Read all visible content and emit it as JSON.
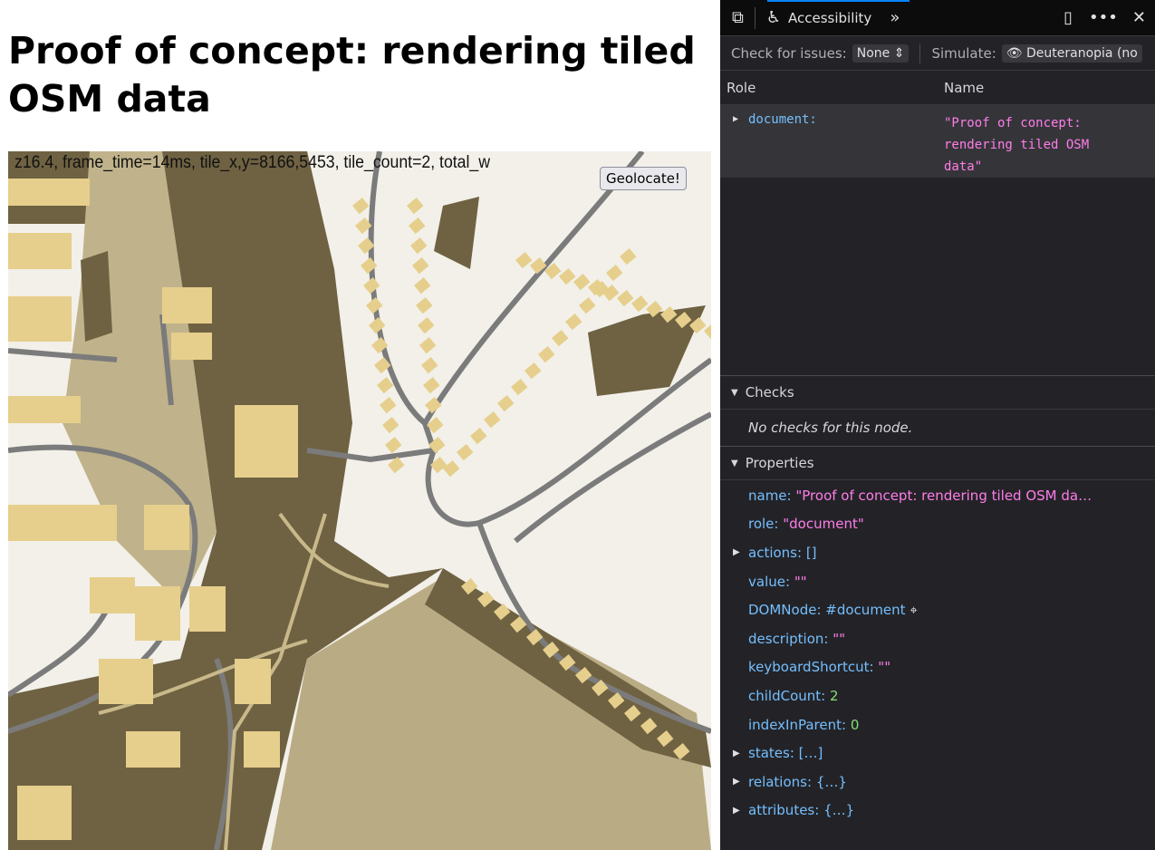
{
  "page": {
    "title": "Proof of concept: rendering tiled OSM data",
    "status": "z16.4, frame_time=14ms, tile_x,y=8166,5453, tile_count=2, total_w",
    "geolocate_label": "Geolocate!"
  },
  "map_colors": {
    "background": "#f2f0e9",
    "forest": "#6f6242",
    "grass": "#c0b38b",
    "landuse": "#b9ab84",
    "building": "#e6cf8c",
    "road": "#7b7b7b",
    "path": "#c9b98a"
  },
  "devtools": {
    "tab": "Accessibility",
    "toolbar": {
      "check_label": "Check for issues:",
      "check_value": "None",
      "simulate_label": "Simulate:",
      "simulate_value": "Deuteranopia (no"
    },
    "columns": {
      "role": "Role",
      "name": "Name"
    },
    "tree": [
      {
        "role": "document:",
        "name": "\"Proof of concept: rendering tiled OSM data\""
      }
    ],
    "checks": {
      "title": "Checks",
      "empty": "No checks for this node."
    },
    "properties": {
      "title": "Properties",
      "items": [
        {
          "key": "name:",
          "value": "\"Proof of concept: rendering tiled OSM da…",
          "type": "s",
          "expandable": false
        },
        {
          "key": "role:",
          "value": "\"document\"",
          "type": "s",
          "expandable": false
        },
        {
          "key": "actions:",
          "value": "[]",
          "type": "k",
          "expandable": true
        },
        {
          "key": "value:",
          "value": "\"\"",
          "type": "s",
          "expandable": false
        },
        {
          "key": "DOMNode:",
          "value": "#document",
          "type": "k",
          "expandable": false,
          "target": true
        },
        {
          "key": "description:",
          "value": "\"\"",
          "type": "s",
          "expandable": false
        },
        {
          "key": "keyboardShortcut:",
          "value": "\"\"",
          "type": "s",
          "expandable": false
        },
        {
          "key": "childCount:",
          "value": "2",
          "type": "n",
          "expandable": false
        },
        {
          "key": "indexInParent:",
          "value": "0",
          "type": "n",
          "expandable": false
        },
        {
          "key": "states:",
          "value": "[…]",
          "type": "k",
          "expandable": true
        },
        {
          "key": "relations:",
          "value": "{…}",
          "type": "k",
          "expandable": true
        },
        {
          "key": "attributes:",
          "value": "{…}",
          "type": "k",
          "expandable": true
        }
      ]
    }
  }
}
